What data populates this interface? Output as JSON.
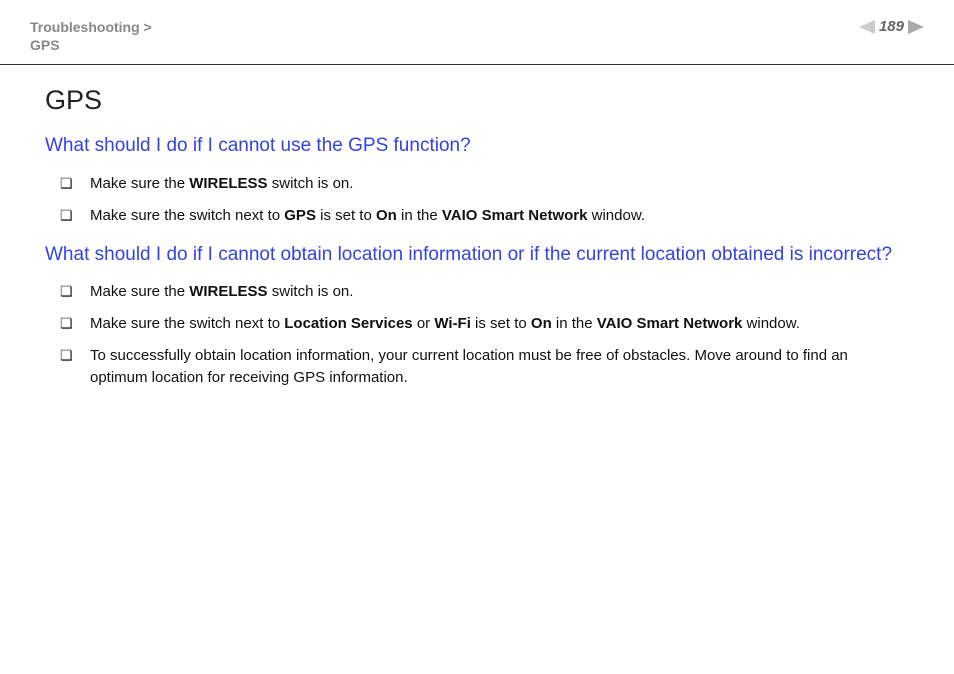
{
  "header": {
    "breadcrumb_parent": "Troubleshooting >",
    "breadcrumb_current": "GPS",
    "page_number": "189"
  },
  "content": {
    "title": "GPS",
    "section1": {
      "heading": "What should I do if I cannot use the GPS function?",
      "items": [
        {
          "prefix": "Make sure the ",
          "bold1": "WIRELESS",
          "suffix": " switch is on."
        },
        {
          "p1": "Make sure the switch next to ",
          "b1": "GPS",
          "p2": " is set to ",
          "b2": "On",
          "p3": " in the ",
          "b3": "VAIO Smart Network",
          "p4": " window."
        }
      ]
    },
    "section2": {
      "heading": "What should I do if I cannot obtain location information or if the current location obtained is incorrect?",
      "items": [
        {
          "prefix": "Make sure the ",
          "bold1": "WIRELESS",
          "suffix": " switch is on."
        },
        {
          "p1": "Make sure the switch next to ",
          "b1": "Location Services",
          "p2": " or ",
          "b2": "Wi-Fi",
          "p3": " is set to ",
          "b3": "On",
          "p4": " in the ",
          "b4": "VAIO Smart Network",
          "p5": " window."
        },
        {
          "text": "To successfully obtain location information, your current location must be free of obstacles. Move around to find an optimum location for receiving GPS information."
        }
      ]
    }
  }
}
